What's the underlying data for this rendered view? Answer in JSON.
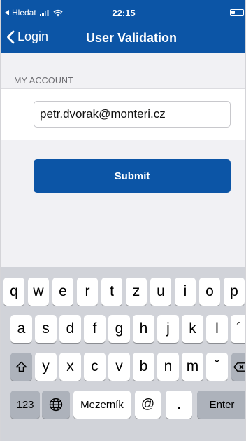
{
  "status_bar": {
    "back_app": "Hledat",
    "time": "22:15"
  },
  "nav": {
    "back_label": "Login",
    "title": "User Validation"
  },
  "form": {
    "section_header": "MY ACCOUNT",
    "email_value": "petr.dvorak@monteri.cz",
    "submit_label": "Submit"
  },
  "keyboard": {
    "row1": [
      "q",
      "w",
      "e",
      "r",
      "t",
      "z",
      "u",
      "i",
      "o",
      "p"
    ],
    "row2": [
      "a",
      "s",
      "d",
      "f",
      "g",
      "h",
      "j",
      "k",
      "l",
      "´"
    ],
    "row3": [
      "y",
      "x",
      "c",
      "v",
      "b",
      "n",
      "m",
      "ˇ"
    ],
    "numbers_key": "123",
    "space_key": "Mezerník",
    "at_key": "@",
    "dot_key": ".",
    "enter_key": "Enter"
  },
  "colors": {
    "brand_blue": "#0c55a6",
    "keyboard_bg": "#d1d3d9",
    "grouped_bg": "#f1f1f4"
  }
}
